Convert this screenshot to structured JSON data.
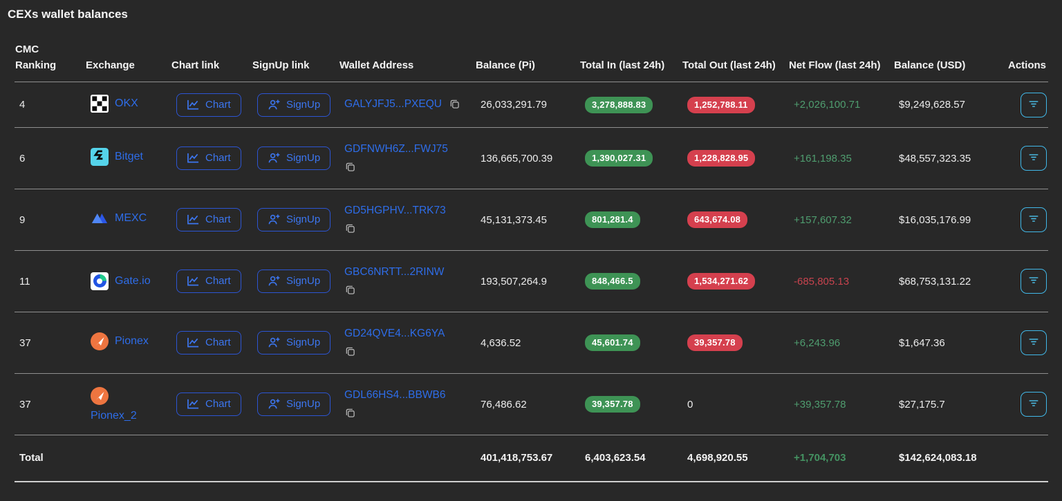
{
  "title": "CEXs wallet balances",
  "colors": {
    "background": "#282828",
    "link_blue": "#2e6de9",
    "badge_green": "#3e9355",
    "badge_red": "#d5404e",
    "net_positive": "#4f9d6f",
    "net_negative": "#c7434e",
    "actions_cyan": "#41b8e8"
  },
  "table": {
    "columns": [
      "CMC Ranking",
      "Exchange",
      "Chart link",
      "SignUp link",
      "Wallet Address",
      "Balance (Pi)",
      "Total In (last 24h)",
      "Total Out (last 24h)",
      "Net Flow (last 24h)",
      "Balance (USD)",
      "Actions"
    ],
    "chart_label": "Chart",
    "signup_label": "SignUp",
    "rows": [
      {
        "ranking": "4",
        "exchange": "OKX",
        "wallet": "GALYJFJ5...PXEQU",
        "balance_pi": "26,033,291.79",
        "total_in": "3,278,888.83",
        "total_out": "1,252,788.11",
        "net_flow": "+2,026,100.71",
        "balance_usd": "$9,249,628.57"
      },
      {
        "ranking": "6",
        "exchange": "Bitget",
        "wallet": "GDFNWH6Z...FWJ75",
        "balance_pi": "136,665,700.39",
        "total_in": "1,390,027.31",
        "total_out": "1,228,828.95",
        "net_flow": "+161,198.35",
        "balance_usd": "$48,557,323.35"
      },
      {
        "ranking": "9",
        "exchange": "MEXC",
        "wallet": "GD5HGPHV...TRK73",
        "balance_pi": "45,131,373.45",
        "total_in": "801,281.4",
        "total_out": "643,674.08",
        "net_flow": "+157,607.32",
        "balance_usd": "$16,035,176.99"
      },
      {
        "ranking": "11",
        "exchange": "Gate.io",
        "wallet": "GBC6NRTT...2RINW",
        "balance_pi": "193,507,264.9",
        "total_in": "848,466.5",
        "total_out": "1,534,271.62",
        "net_flow": "-685,805.13",
        "balance_usd": "$68,753,131.22"
      },
      {
        "ranking": "37",
        "exchange": "Pionex",
        "wallet": "GD24QVE4...KG6YA",
        "balance_pi": "4,636.52",
        "total_in": "45,601.74",
        "total_out": "39,357.78",
        "net_flow": "+6,243.96",
        "balance_usd": "$1,647.36"
      },
      {
        "ranking": "37",
        "exchange": "Pionex_2",
        "wallet": "GDL66HS4...BBWB6",
        "balance_pi": "76,486.62",
        "total_in": "39,357.78",
        "total_out": "0",
        "net_flow": "+39,357.78",
        "balance_usd": "$27,175.7"
      }
    ],
    "total": {
      "label": "Total",
      "balance_pi": "401,418,753.67",
      "total_in": "6,403,623.54",
      "total_out": "4,698,920.55",
      "net_flow": "+1,704,703",
      "balance_usd": "$142,624,083.18"
    }
  }
}
